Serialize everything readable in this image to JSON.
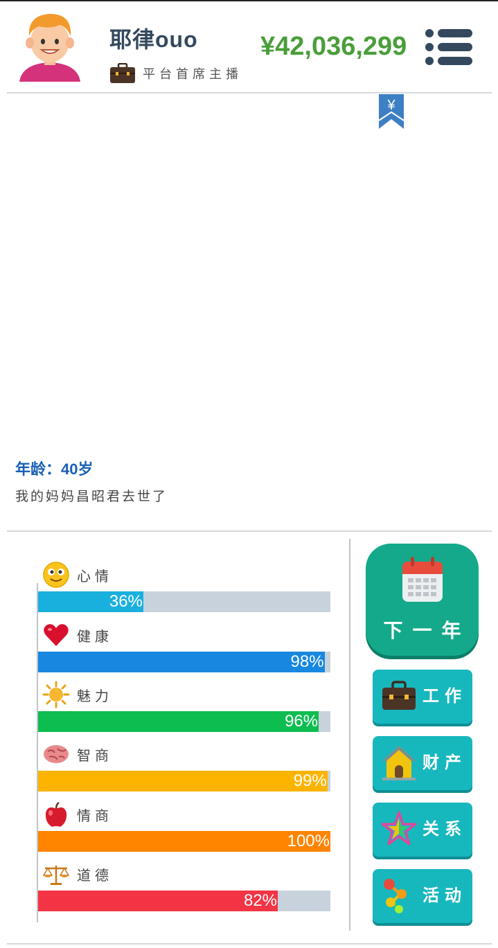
{
  "header": {
    "username": "耶律ouo",
    "job_title": "平台首席主播",
    "money": "¥42,036,299",
    "avatar_icon": "boy-avatar-icon",
    "job_icon": "briefcase-icon",
    "menu_icon": "menu-icon"
  },
  "bookmark": {
    "symbol": "¥",
    "icon": "yen-bookmark-icon"
  },
  "event": {
    "age_label": "年龄：40岁",
    "message": "我的妈妈昌昭君去世了"
  },
  "stats": [
    {
      "label": "心情",
      "percent_text": "36%",
      "value": 36,
      "color": "#1ab0de",
      "icon": "smiley-icon"
    },
    {
      "label": "健康",
      "percent_text": "98%",
      "value": 98,
      "color": "#1787e0",
      "icon": "heart-icon"
    },
    {
      "label": "魅力",
      "percent_text": "96%",
      "value": 96,
      "color": "#0ebd50",
      "icon": "sun-icon"
    },
    {
      "label": "智商",
      "percent_text": "99%",
      "value": 99,
      "color": "#fcb400",
      "icon": "brain-icon"
    },
    {
      "label": "情商",
      "percent_text": "100%",
      "value": 100,
      "color": "#ff8500",
      "icon": "apple-icon"
    },
    {
      "label": "道德",
      "percent_text": "82%",
      "value": 82,
      "color": "#f23444",
      "icon": "scales-icon"
    }
  ],
  "actions": {
    "next_year": {
      "label": "下一年",
      "icon": "calendar-icon"
    },
    "work": {
      "label": "工作",
      "icon": "briefcase-icon"
    },
    "property": {
      "label": "财产",
      "icon": "house-icon"
    },
    "relations": {
      "label": "关系",
      "icon": "star-icon"
    },
    "activities": {
      "label": "活动",
      "icon": "molecule-icon"
    }
  },
  "colors": {
    "money": "#4a9e3a",
    "age": "#1a5fb4",
    "next_button": "#14a98a",
    "side_button": "#17b7be"
  }
}
